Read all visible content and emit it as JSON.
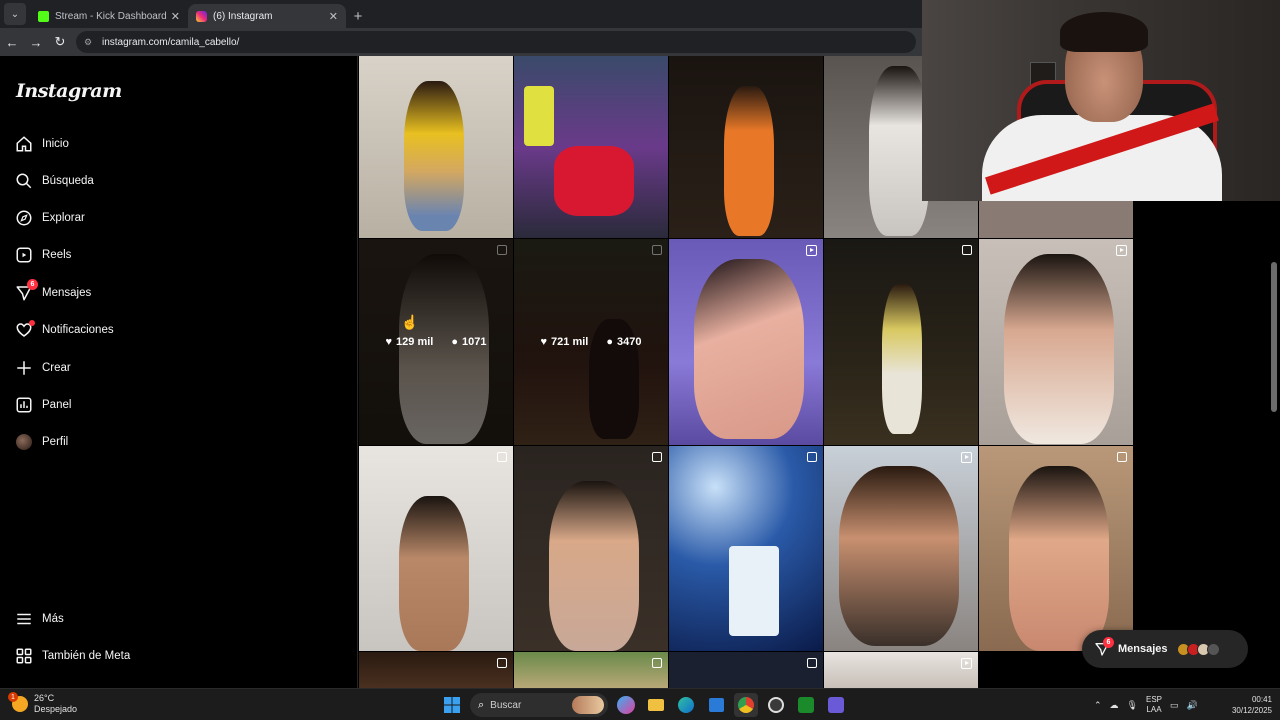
{
  "browser": {
    "tabs": [
      {
        "title": "Stream - Kick Dashboard",
        "active": false
      },
      {
        "title": "(6) Instagram",
        "active": true
      }
    ],
    "url": "instagram.com/camila_cabello/"
  },
  "sidebar": {
    "logo": "Instagram",
    "items": [
      {
        "label": "Inicio",
        "icon": "home-icon"
      },
      {
        "label": "Búsqueda",
        "icon": "search-icon"
      },
      {
        "label": "Explorar",
        "icon": "compass-icon"
      },
      {
        "label": "Reels",
        "icon": "reels-icon"
      },
      {
        "label": "Mensajes",
        "icon": "messenger-icon",
        "badge": "6"
      },
      {
        "label": "Notificaciones",
        "icon": "heart-icon",
        "dot": true
      },
      {
        "label": "Crear",
        "icon": "plus-icon"
      },
      {
        "label": "Panel",
        "icon": "chart-icon"
      },
      {
        "label": "Perfil",
        "icon": "avatar"
      }
    ],
    "bottom": [
      {
        "label": "Más",
        "icon": "menu-icon"
      },
      {
        "label": "También de Meta",
        "icon": "meta-icon"
      }
    ]
  },
  "grid": {
    "hovered_posts": [
      {
        "likes": "129 mil",
        "comments": "1071"
      },
      {
        "likes": "721 mil",
        "comments": "3470"
      }
    ]
  },
  "messages_pill": {
    "label": "Mensajes",
    "badge": "6"
  },
  "taskbar": {
    "weather": {
      "temp": "26°C",
      "desc": "Despejado",
      "badge": "1"
    },
    "search_placeholder": "Buscar",
    "lang_top": "ESP",
    "lang_bottom": "LAA",
    "time": "00:41",
    "date": "30/12/2025"
  },
  "colors": {
    "ig_bg": "#000000",
    "notif_red": "#ff3040",
    "chrome_dark": "#202124"
  }
}
